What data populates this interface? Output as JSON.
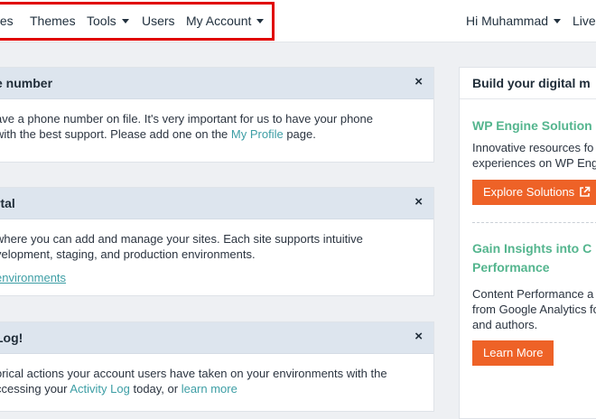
{
  "nav": {
    "items": [
      {
        "label": "tes"
      },
      {
        "label": "Themes"
      },
      {
        "label": "Tools"
      },
      {
        "label": "Users"
      },
      {
        "label": "My Account"
      }
    ],
    "greeting": "Hi Muhammad",
    "live": "Live"
  },
  "cards": {
    "phone": {
      "title": "e number",
      "line1": "ave a phone number on file. It's very important for us to have your phone",
      "line2_pre": "with the best support. Please add one on the ",
      "line2_link": "My Profile",
      "line2_post": " page.",
      "close": "×"
    },
    "portal": {
      "title": "rtal",
      "line1": "where you can add and manage your sites. Each site supports intuitive",
      "line2": "velopment, staging, and production environments.",
      "link": "environments",
      "close": "×"
    },
    "log": {
      "title": "Log!",
      "line1": "orical actions your account users have taken on your environments with the",
      "line2_pre": "ccessing your ",
      "line2_link1": "Activity Log",
      "line2_mid": " today, or ",
      "line2_link2": "learn more",
      "close": "×"
    }
  },
  "sidebar": {
    "title": "Build your digital m",
    "section1": {
      "heading": "WP Engine Solution",
      "line1": "Innovative resources fo",
      "line2": "experiences on WP Engi",
      "button": "Explore Solutions"
    },
    "section2": {
      "heading1": "Gain Insights into C",
      "heading2": "Performance",
      "line1": "Content Performance a",
      "line2": "from Google Analytics fo",
      "line3": "and authors.",
      "button": "Learn More"
    }
  },
  "colors": {
    "accent_orange": "#ee6227",
    "link_teal": "#3d9ea5",
    "heading_green": "#54b58e",
    "highlight_red": "#e00000"
  }
}
